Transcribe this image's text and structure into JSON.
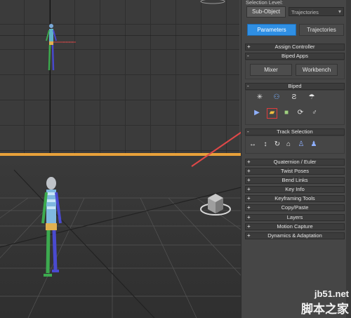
{
  "panel": {
    "selection_level_label": "Selection Level:",
    "sub_object_button": "Sub-Object",
    "selection_dropdown": "Trajectories",
    "tabs": [
      {
        "label": "Parameters",
        "active": true
      },
      {
        "label": "Trajectories",
        "active": false
      }
    ],
    "rollouts": {
      "assign_controller": "Assign Controller",
      "biped_apps": "Biped Apps",
      "biped": "Biped",
      "track_selection": "Track Selection",
      "quaternion_euler": "Quaternion / Euler",
      "twist_poses": "Twist Poses",
      "bend_links": "Bend Links",
      "key_info": "Key Info",
      "keyframing_tools": "Keyframing Tools",
      "copy_paste": "Copy/Paste",
      "layers": "Layers",
      "motion_capture": "Motion Capture",
      "dynamics_adaptation": "Dynamics & Adaptation"
    },
    "biped_apps_buttons": {
      "mixer": "Mixer",
      "workbench": "Workbench"
    },
    "rollout_signs": {
      "collapsed": "+",
      "expanded": "-"
    }
  },
  "watermark": {
    "site": "jb51.net",
    "name": "脚本之家"
  },
  "colors": {
    "active_tab": "#2f8fe4",
    "highlight_box": "#e03c3c",
    "arrow": "#e04848",
    "viewport_border": "#e8a13a"
  },
  "icons": [
    "figure-mode-icon",
    "footstep-mode-icon",
    "motion-flow-icon",
    "mixer-mode-icon",
    "biped-playback-icon",
    "load-file-icon",
    "save-file-icon",
    "convert-icon",
    "move-all-mode-icon",
    "body-horizontal-icon",
    "body-vertical-icon",
    "body-rotation-icon",
    "lock-cog-icon",
    "symmetrical-icon",
    "opposite-icon"
  ]
}
